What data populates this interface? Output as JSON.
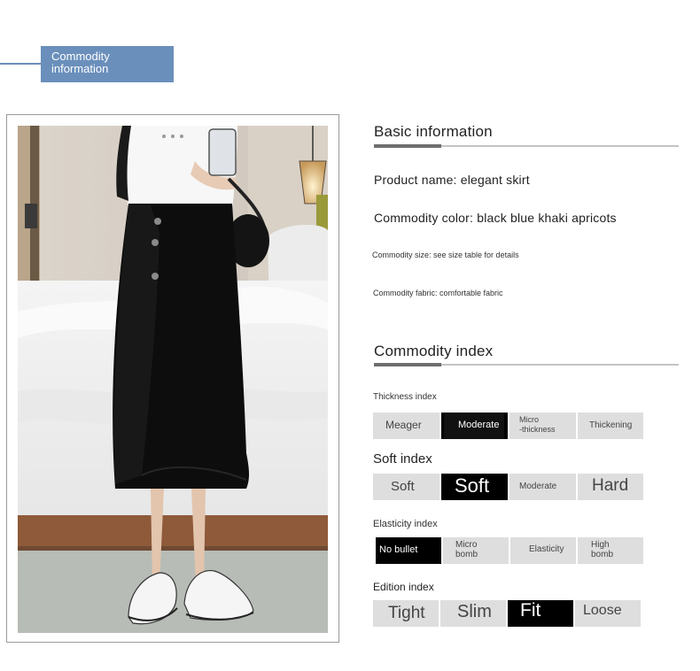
{
  "header": {
    "tab_line1": "Commodity",
    "tab_line2": "information"
  },
  "basic": {
    "title": "Basic information",
    "product_name": "Product name: elegant skirt",
    "color": "Commodity color: black blue khaki apricots",
    "size": "Commodity size: see size table for details",
    "fabric": "Commodity fabric: comfortable fabric"
  },
  "index": {
    "title": "Commodity index",
    "thickness": {
      "label": "Thickness index",
      "options": [
        "Meager",
        "Moderate",
        "Micro",
        "-thickness",
        "Thickening"
      ],
      "selected": "Moderate"
    },
    "soft": {
      "label": "Soft index",
      "options": [
        "Soft",
        "Soft",
        "Moderate",
        "Hard"
      ],
      "selected_index": 1
    },
    "elasticity": {
      "label": "Elasticity index",
      "options": [
        "No bullet",
        "Micro",
        "bomb",
        "Elasticity",
        "High",
        "bomb"
      ],
      "selected": "No bullet"
    },
    "edition": {
      "label": "Edition index",
      "options": [
        "Tight",
        "Slim",
        "Fit",
        "Loose"
      ],
      "selected": "Fit"
    }
  },
  "colors": {
    "accent": "#6a8fbb",
    "selected": "#000000",
    "unselected": "#dedede"
  }
}
